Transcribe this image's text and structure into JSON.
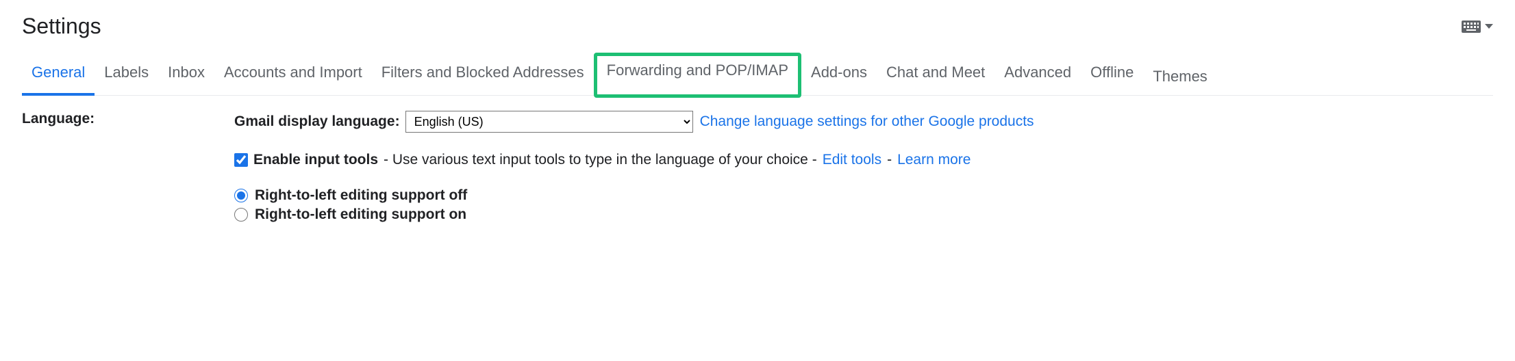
{
  "title": "Settings",
  "tabs": {
    "general": "General",
    "labels": "Labels",
    "inbox": "Inbox",
    "accounts": "Accounts and Import",
    "filters": "Filters and Blocked Addresses",
    "forwarding": "Forwarding and POP/IMAP",
    "addons": "Add-ons",
    "chat": "Chat and Meet",
    "advanced": "Advanced",
    "offline": "Offline",
    "themes": "Themes"
  },
  "language": {
    "section_label": "Language:",
    "display_label": "Gmail display language:",
    "selected": "English (US)",
    "change_link": "Change language settings for other Google products",
    "enable_input_tools_label": "Enable input tools",
    "enable_input_tools_desc": " - Use various text input tools to type in the language of your choice - ",
    "edit_tools": "Edit tools",
    "dash": " - ",
    "learn_more": "Learn more",
    "rtl_off": "Right-to-left editing support off",
    "rtl_on": "Right-to-left editing support on"
  }
}
